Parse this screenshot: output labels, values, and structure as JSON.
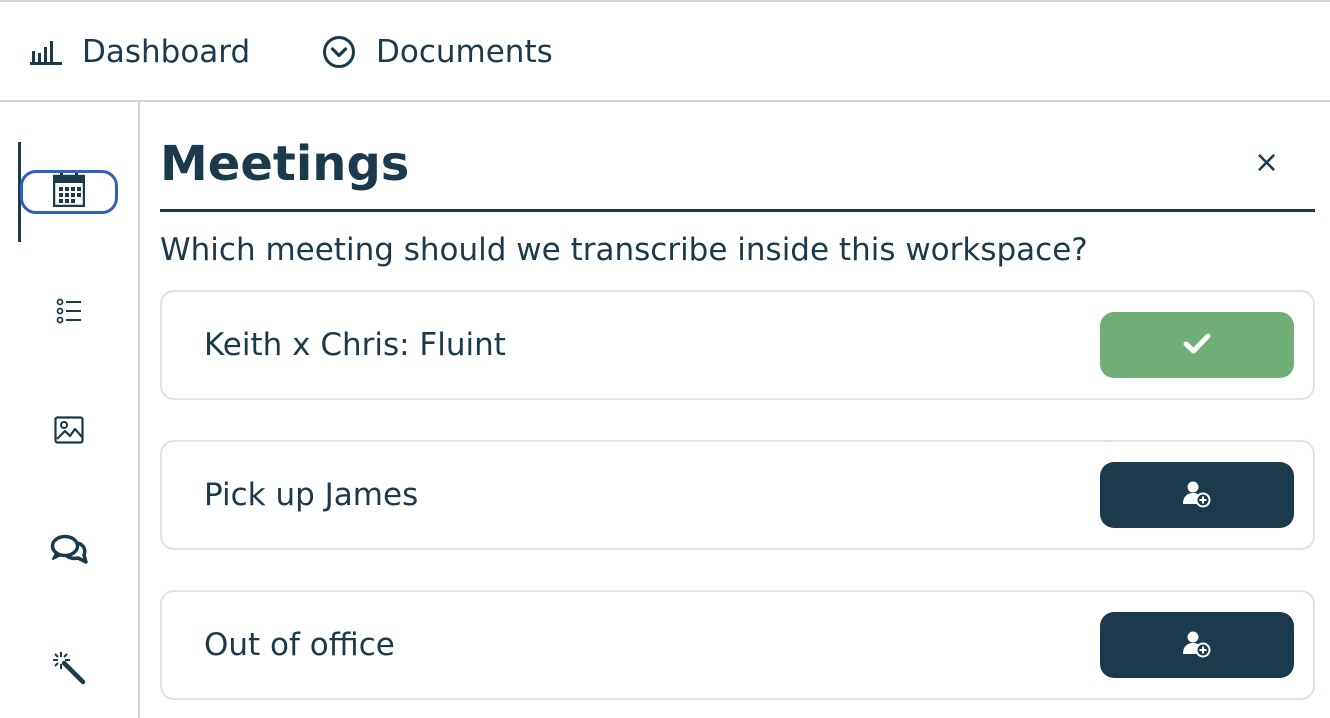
{
  "topnav": {
    "items": [
      {
        "label": "Dashboard",
        "icon": "bar-chart-icon"
      },
      {
        "label": "Documents",
        "icon": "chevron-down-circle-icon"
      }
    ]
  },
  "sidebar": {
    "items": [
      {
        "icon": "calendar-icon",
        "active": true
      },
      {
        "icon": "list-icon",
        "active": false
      },
      {
        "icon": "image-icon",
        "active": false
      },
      {
        "icon": "chat-bubbles-icon",
        "active": false
      },
      {
        "icon": "magic-wand-icon",
        "active": false
      }
    ]
  },
  "panel": {
    "title": "Meetings",
    "close_label": "×",
    "subtitle": "Which meeting should we transcribe inside this workspace?",
    "meetings": [
      {
        "name": "Keith x Chris: Fluint",
        "state": "added",
        "action_icon": "checkmark-icon"
      },
      {
        "name": "Pick up James",
        "state": "add",
        "action_icon": "add-user-icon"
      },
      {
        "name": "Out of office",
        "state": "add",
        "action_icon": "add-user-icon"
      }
    ]
  },
  "colors": {
    "primary": "#1b3a4b",
    "added": "#6fae74",
    "focus": "#2f5fc0",
    "border": "#d0d5da"
  }
}
